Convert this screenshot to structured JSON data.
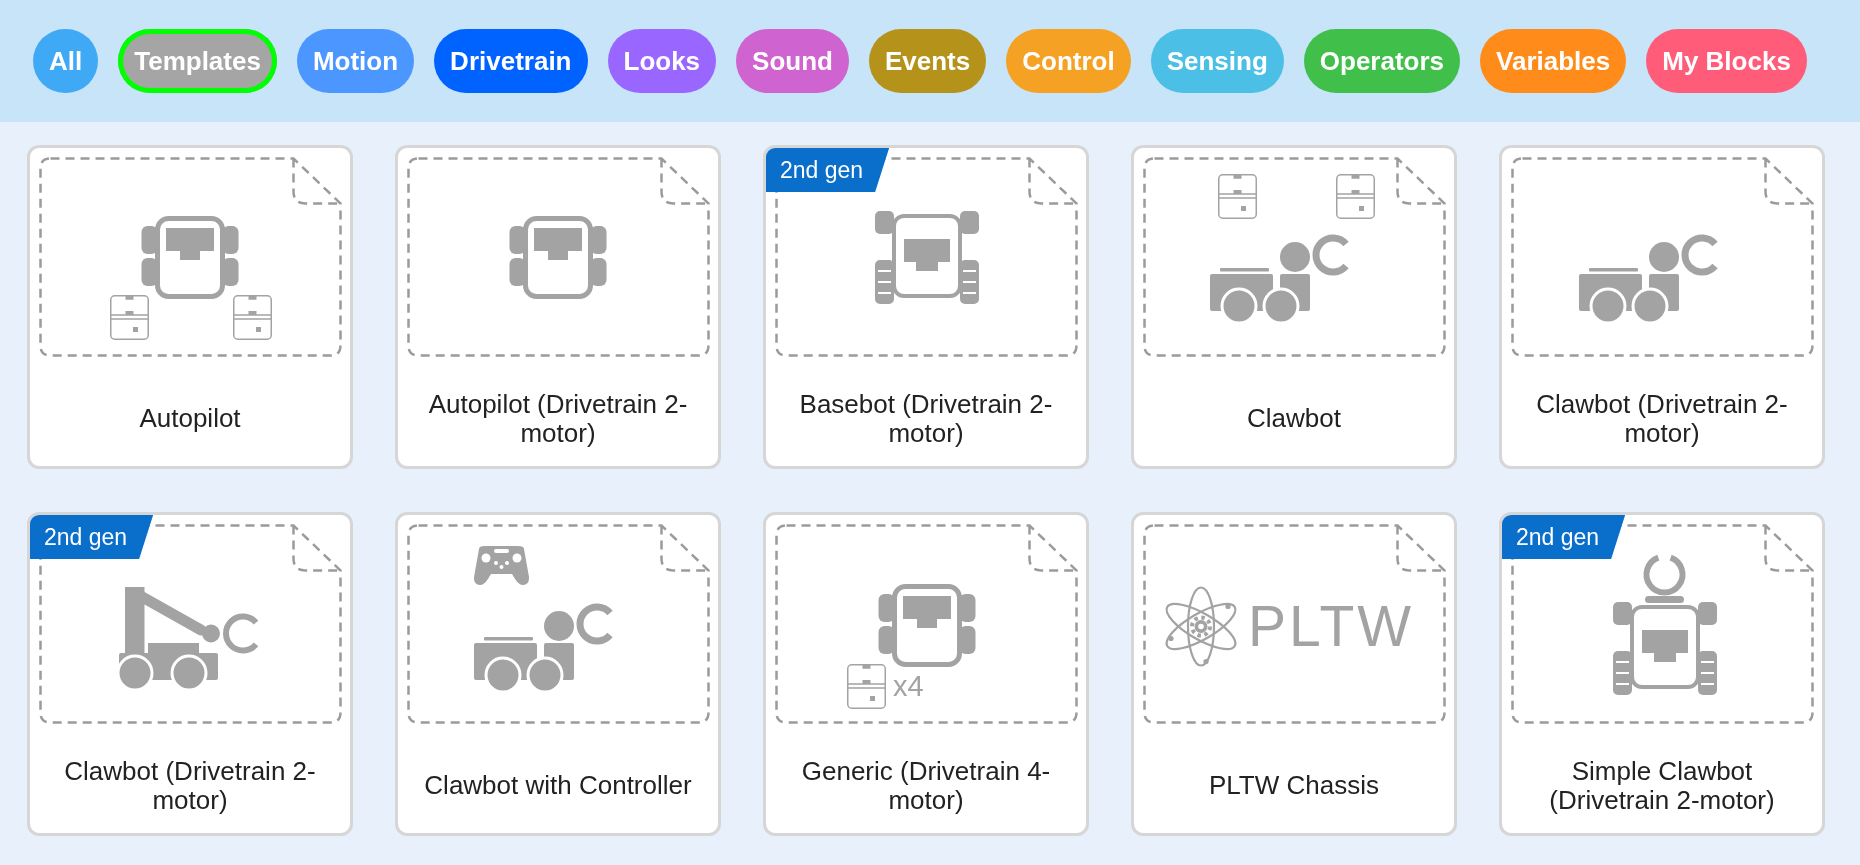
{
  "categories": [
    {
      "label": "All",
      "color": "#3fa9f5",
      "selected": false
    },
    {
      "label": "Templates",
      "color": "#a5a5a5",
      "selected": true
    },
    {
      "label": "Motion",
      "color": "#4c97ff",
      "selected": false
    },
    {
      "label": "Drivetrain",
      "color": "#0062ff",
      "selected": false
    },
    {
      "label": "Looks",
      "color": "#9966ff",
      "selected": false
    },
    {
      "label": "Sound",
      "color": "#cf63cf",
      "selected": false
    },
    {
      "label": "Events",
      "color": "#b5921a",
      "selected": false
    },
    {
      "label": "Control",
      "color": "#f4a124",
      "selected": false
    },
    {
      "label": "Sensing",
      "color": "#4cbfe6",
      "selected": false
    },
    {
      "label": "Operators",
      "color": "#40bf4a",
      "selected": false
    },
    {
      "label": "Variables",
      "color": "#ff8c1a",
      "selected": false
    },
    {
      "label": "My Blocks",
      "color": "#ff5c7a",
      "selected": false
    }
  ],
  "templates": [
    {
      "title": "Autopilot",
      "kind": "autopilot"
    },
    {
      "title": "Autopilot (Drivetrain 2-motor)",
      "kind": "brain"
    },
    {
      "title": "Basebot (Drivetrain 2-motor)",
      "kind": "basebot",
      "badge": "2nd gen"
    },
    {
      "title": "Clawbot",
      "kind": "clawbot"
    },
    {
      "title": "Clawbot (Drivetrain 2-motor)",
      "kind": "clawbase"
    },
    {
      "title": "Clawbot (Drivetrain 2-motor)",
      "kind": "armbot",
      "badge": "2nd gen"
    },
    {
      "title": "Clawbot with Controller",
      "kind": "controller"
    },
    {
      "title": "Generic (Drivetrain 4-motor)",
      "kind": "generic",
      "multiplier": "x4"
    },
    {
      "title": "PLTW Chassis",
      "kind": "pltw",
      "logo_text": "PLTW"
    },
    {
      "title": "Simple Clawbot (Drivetrain 2-motor)",
      "kind": "simpleclaw",
      "badge": "2nd gen"
    }
  ]
}
